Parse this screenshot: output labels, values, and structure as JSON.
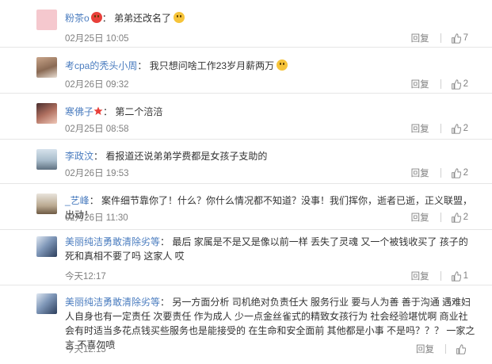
{
  "ui": {
    "reply_label": "回复",
    "colon": "："
  },
  "comments": [
    {
      "user": "粉茶o",
      "text": "弟弟还改名了",
      "time": "02月25日 10:05",
      "likes": "7"
    },
    {
      "user": "考cpa的秃头小周",
      "text": "我只想问啥工作23岁月薪两万",
      "time": "02月26日 09:32",
      "likes": "2"
    },
    {
      "user": "寒佛子",
      "text": "第二个涪涪",
      "time": "02月25日 08:58",
      "likes": "2"
    },
    {
      "user": "李政汶",
      "text": "看报道还说弟弟学费都是女孩子支助的",
      "time": "02月26日 19:53",
      "likes": "2"
    },
    {
      "user": "_艺峰",
      "text": "案件细节靠你了！什么？你什么情况都不知道？没事！我们挥你，逝者已逝，正义联盟，出动！",
      "time": "02月26日 11:30",
      "likes": "2"
    },
    {
      "user": "美丽纯洁勇敢清除劣等",
      "text": "最后 家属是不是又是像以前一样 丢失了灵魂 又一个被钱收买了 孩子的死和真相不要了吗 这家人 哎",
      "time": "今天12:17",
      "likes": "1"
    },
    {
      "user": "美丽纯洁勇敢清除劣等",
      "text": "另一方面分析 司机绝对负责任大 服务行业 要与人为善 善于沟通 遇难妇人自身也有一定责任 次要责任 作为成人 少一点金丝雀式的精致女孩行为 社会经验堪忧啊 商业社会有时适当多花点钱买些服务也是能接受的 在生命和安全面前 其他都是小事 不是吗？？？ 一家之言 不喜勿喷",
      "time": "今天12:15",
      "likes": ""
    }
  ]
}
